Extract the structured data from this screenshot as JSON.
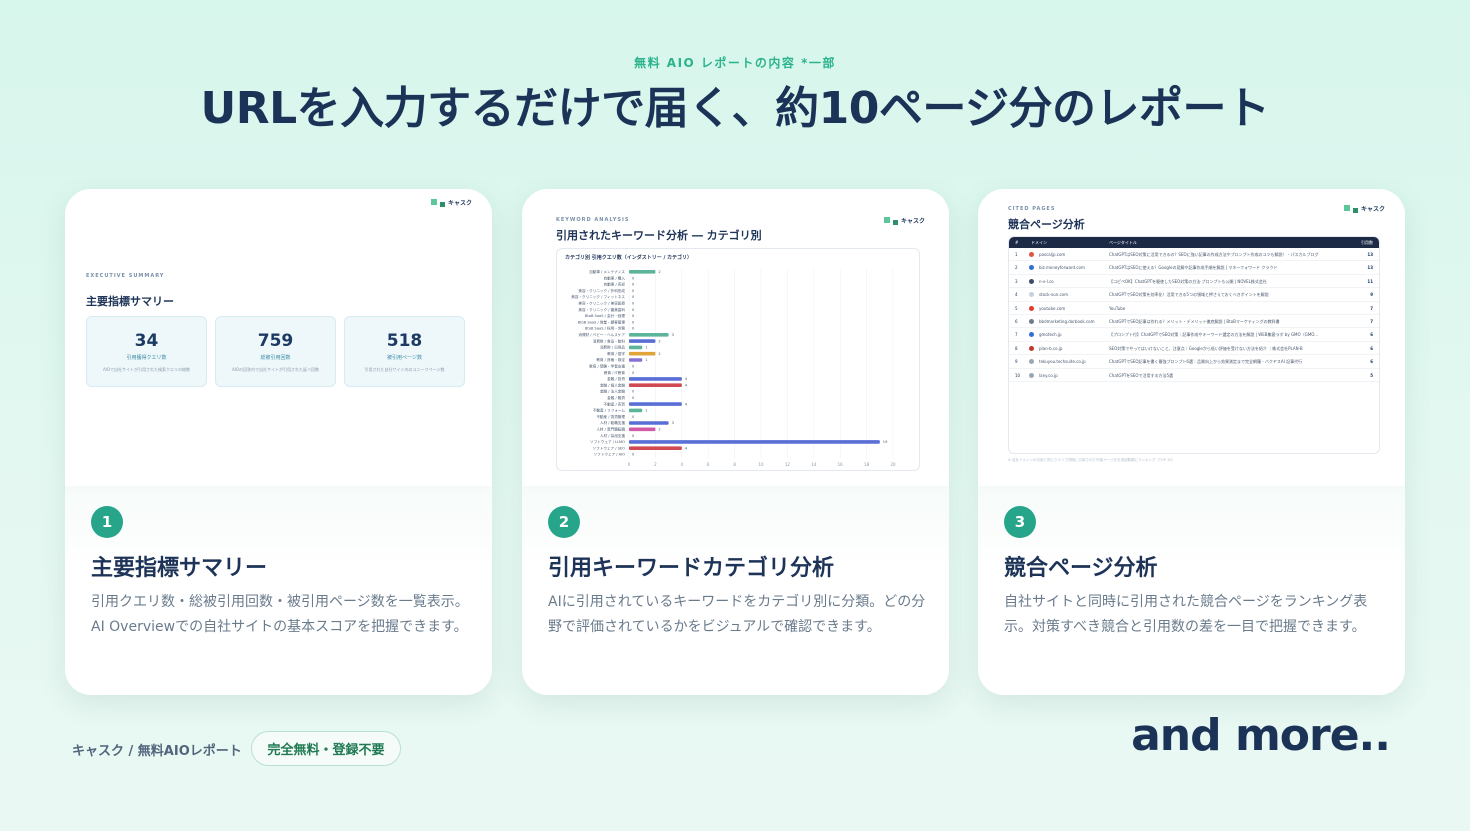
{
  "header": {
    "eyebrow": "無料 AIO レポートの内容 *一部",
    "title": "URLを入力するだけで届く、約10ページ分のレポート"
  },
  "logo_text": "キャスク",
  "cards": [
    {
      "number": "1",
      "title": "主要指標サマリー",
      "description": "引用クエリ数・総被引用回数・被引用ページ数を一覧表示。AI Overviewでの自社サイトの基本スコアを把握できます。",
      "preview": {
        "eyebrow": "EXECUTIVE SUMMARY",
        "title": "主要指標サマリー",
        "kpis": [
          {
            "value": "34",
            "label": "引用獲得クエリ数",
            "sub": "AIOで自社サイトが引用された検索クエリの総数"
          },
          {
            "value": "759",
            "label": "総被引用回数",
            "sub": "AIOの回答内で自社サイトが引用された延べ回数"
          },
          {
            "value": "518",
            "label": "被引用ページ数",
            "sub": "引用された自社サイト内のユニークページ数"
          }
        ]
      }
    },
    {
      "number": "2",
      "title": "引用キーワードカテゴリ分析",
      "description": "AIに引用されているキーワードをカテゴリ別に分類。どの分野で評価されているかをビジュアルで確認できます。",
      "preview": {
        "eyebrow": "KEYWORD ANALYSIS",
        "title": "引用されたキーワード分析 ― カテゴリ別",
        "chart_title": "カテゴリ別 引用クエリ数（インダストリー / カテゴリ）"
      }
    },
    {
      "number": "3",
      "title": "競合ページ分析",
      "description": "自社サイトと同時に引用された競合ページをランキング表示。対策すべき競合と引用数の差を一目で把握できます。",
      "preview": {
        "eyebrow": "CITED PAGES",
        "title": "競合ページ分析",
        "columns": [
          "#",
          "ドメイン",
          "ページタイトル",
          "引用数"
        ],
        "rows": [
          {
            "rank": "1",
            "domain": "pascaljp.com",
            "title": "ChatGPTはSEO対策に活用できるの？SEOに強い記事の作成方法やプロンプト作成のコツも解説！ - パスカルブログ",
            "count": "13",
            "color": "#e0533d"
          },
          {
            "rank": "2",
            "domain": "biz.moneyforward.com",
            "title": "ChatGPTはSEOに使える？Googleの見解や記事作成手順を解説 | マネーフォワード クラウド",
            "count": "13",
            "color": "#2f6fd6"
          },
          {
            "rank": "3",
            "domain": "n-v-l.co",
            "title": "【コピペOK】ChatGPTを駆使したSEO対策の方法·プロンプトも公開 | NOVEL株式会社",
            "count": "11",
            "color": "#3b4a6b"
          },
          {
            "rank": "4",
            "domain": "stock-sun.com",
            "title": "ChatGPTでSEO対策を効率化！活用できる5つの領域と押さえておくべきポイントを解説",
            "count": "9",
            "color": "#c9d2dc"
          },
          {
            "rank": "5",
            "domain": "youtube.com",
            "title": "YouTube",
            "count": "7",
            "color": "#e23b2e"
          },
          {
            "rank": "6",
            "domain": "bbdmarketing.dorbook.com",
            "title": "ChatGPTでSEO記事は作れる？メリット・デメリット徹底解説 | BtoBマーケティングの教科書",
            "count": "7",
            "color": "#6c7a8c"
          },
          {
            "rank": "7",
            "domain": "gmotech.jp",
            "title": "【プロンプト付】ChatGPTでSEO対策｜記事作成やキーワード選定の方法を解説 | WEB集客ラボ by GMO（GMO...",
            "count": "6",
            "color": "#2f6fd6"
          },
          {
            "rank": "8",
            "domain": "plan-b.co.jp",
            "title": "SEO対策でやってはいけないこと、注意点｜Googleから低い評価を受けない方法を紹介 ｜株式会社PLAN-B",
            "count": "6",
            "color": "#c0392b"
          },
          {
            "rank": "9",
            "domain": "tekuyou.techsuite.co.jp",
            "title": "ChatGPTでSEO記事を書く最強プロンプト6選｜品質向上から効果測定まで完全網羅 - バクヤスAI 記事代行",
            "count": "6",
            "color": "#9aa7b5"
          },
          {
            "rank": "10",
            "domain": "lany.co.jp",
            "title": "ChatGPTをSEOで活用する方法5選",
            "count": "5",
            "color": "#9aa7b5"
          }
        ],
        "note": "※ 自社ドメインの引用と同じクエリで同時に引用された外部ページを引用回数順にランキング（TOP 10）"
      }
    }
  ],
  "chart_data": {
    "type": "bar",
    "orientation": "horizontal",
    "title": "カテゴリ別 引用クエリ数（インダストリー / カテゴリ）",
    "categories": [
      "自動車 / メンテナンス",
      "自動車 / 購入",
      "自動車 / 売却",
      "美容・クリニック / 外科形成",
      "美容・クリニック / フィットネス",
      "美容・クリニック / 美容医療",
      "美容・クリニック / 審美歯科",
      "BtoB SaaS / 会計・経理",
      "BtoB SaaS / 営業・顧客管理",
      "BtoB SaaS / 採用・労務",
      "消費財 / ベビー・ヘルスケア",
      "消費財 / 食品・飲料",
      "消費財 / 日用品",
      "教育 / 語学",
      "教育 / 資格・検定",
      "教育 / 受験・学習支援",
      "教育 / IT教育",
      "金融 / 投資",
      "金融 / 個人金融",
      "金融 / 法人金融",
      "金融 / 融資",
      "不動産 / 売買",
      "不動産 / リフォーム",
      "不動産 / 賃貸管理",
      "人材 / 転職支援",
      "人材 / 専門職転職",
      "人材 / 採用支援",
      "ソフトウェア / LLMO",
      "ソフトウェア / SEO",
      "ソフトウェア / AIO"
    ],
    "values": [
      2,
      0,
      0,
      0,
      0,
      0,
      0,
      0,
      0,
      0,
      3,
      2,
      1,
      2,
      1,
      0,
      0,
      4,
      4,
      0,
      0,
      4,
      1,
      0,
      3,
      2,
      0,
      19,
      4,
      0
    ],
    "colors": [
      "#5cb59a",
      "#5cb59a",
      "#5cb59a",
      "#5cb59a",
      "#5cb59a",
      "#5cb59a",
      "#5cb59a",
      "#5cb59a",
      "#5cb59a",
      "#5cb59a",
      "#5cb59a",
      "#5a6fd6",
      "#5cb59a",
      "#e0a43a",
      "#8a6fd6",
      "#5cb59a",
      "#5cb59a",
      "#5a6fd6",
      "#d04a52",
      "#5cb59a",
      "#5cb59a",
      "#5a6fd6",
      "#5cb59a",
      "#5cb59a",
      "#5a6fd6",
      "#d05aa6",
      "#5cb59a",
      "#5a6fd6",
      "#d04a52",
      "#5cb59a"
    ],
    "xlim": [
      0,
      20
    ],
    "xticks": [
      0,
      2,
      4,
      6,
      8,
      10,
      12,
      14,
      16,
      18,
      20
    ]
  },
  "footer": {
    "label": "キャスク / 無料AIOレポート",
    "pill": "完全無料・登録不要",
    "more": "and more.."
  }
}
